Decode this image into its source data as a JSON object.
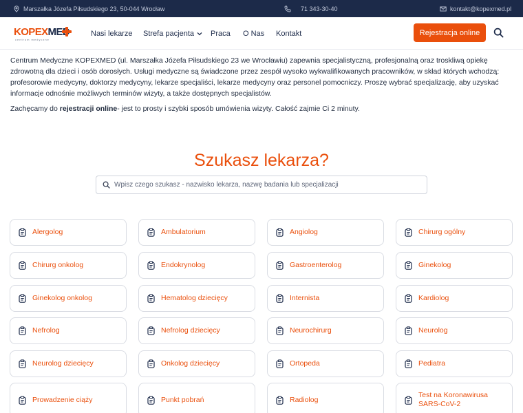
{
  "topbar": {
    "address": "Marszałka Józefa Piłsudskiego 23, 50-044 Wrocław",
    "phone": "71 343-30-40",
    "email": "kontakt@kopexmed.pl"
  },
  "logo": {
    "kopex": "KOPEX",
    "med": "MED",
    "subtitle": "centrum medyczne"
  },
  "nav": {
    "items": [
      {
        "label": "Nasi lekarze"
      },
      {
        "label": "Strefa pacjenta"
      },
      {
        "label": "Praca"
      },
      {
        "label": "O Nas"
      },
      {
        "label": "Kontakt"
      }
    ],
    "register_label": "Rejestracja online"
  },
  "intro": {
    "paragraph": "Centrum Medyczne KOPEXMED (ul. Marszałka Józefa Piłsudskiego 23 we Wrocławiu) zapewnia specjalistyczną, profesjonalną oraz troskliwą opiekę zdrowotną dla dzieci i osób dorosłych. Usługi medyczne są świadczone przez zespół wysoko wykwalifikowanych pracowników, w skład których wchodzą: profesorowie medycyny, doktorzy medycyny, lekarze specjaliści, lekarze medycyny oraz personel pomocniczy. Proszę wybrać specjalizację, aby uzyskać informacje odnośnie możliwych terminów wizyty, a także dostępnych specjalistów.",
    "cta_before": "Zachęcamy do ",
    "cta_bold": "rejestracji online",
    "cta_after": "- jest to prosty i szybki sposób umówienia wizyty. Całość zajmie Ci 2 minuty."
  },
  "search": {
    "headline": "Szukasz lekarza?",
    "placeholder": "Wpisz czego szukasz - nazwisko lekarza, nazwę badania lub specjalizacji"
  },
  "specializations": [
    {
      "label": "Alergolog"
    },
    {
      "label": "Ambulatorium"
    },
    {
      "label": "Angiolog"
    },
    {
      "label": "Chirurg ogólny"
    },
    {
      "label": "Chirurg onkolog"
    },
    {
      "label": "Endokrynolog"
    },
    {
      "label": "Gastroenterolog"
    },
    {
      "label": "Ginekolog"
    },
    {
      "label": "Ginekolog onkolog"
    },
    {
      "label": "Hematolog dziecięcy"
    },
    {
      "label": "Internista"
    },
    {
      "label": "Kardiolog"
    },
    {
      "label": "Nefrolog"
    },
    {
      "label": "Nefrolog dziecięcy"
    },
    {
      "label": "Neurochirurg"
    },
    {
      "label": "Neurolog"
    },
    {
      "label": "Neurolog dziecięcy"
    },
    {
      "label": "Onkolog dziecięcy"
    },
    {
      "label": "Ortopeda"
    },
    {
      "label": "Pediatra"
    },
    {
      "label": "Prowadzenie ciąży"
    },
    {
      "label": "Punkt pobrań"
    },
    {
      "label": "Radiolog"
    },
    {
      "label": "Test na Koronawirusa SARS-CoV-2"
    }
  ],
  "colors": {
    "accent": "#ea4f0c",
    "navy": "#1c2a49",
    "topbar": "#1c2a49"
  },
  "icons": {
    "address": "map-pin-icon",
    "phone": "phone-icon",
    "email": "envelope-icon",
    "search": "magnifier-icon",
    "specialization": "clipboard-icon"
  }
}
